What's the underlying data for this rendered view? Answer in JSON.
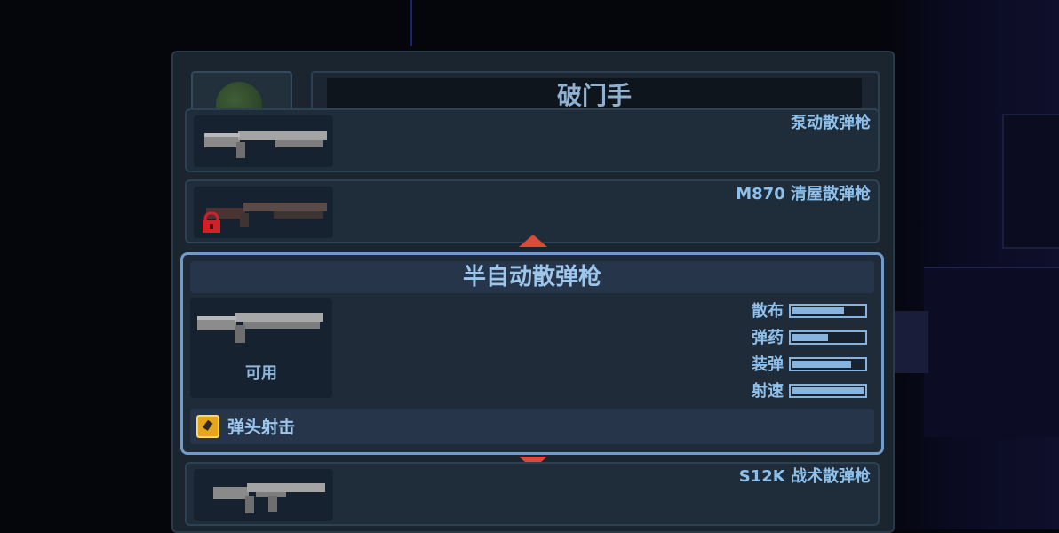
{
  "character": {
    "name": "破门手",
    "avatar_icon": "character-portrait-icon"
  },
  "weapons": [
    {
      "name": "泵动散弹枪",
      "locked": false,
      "icon": "shotgun-icon"
    },
    {
      "name": "M870 清屋散弹枪",
      "locked": true,
      "icon": "shotgun-icon"
    },
    {
      "name": "S12K 战术散弹枪",
      "locked": false,
      "icon": "tactical-shotgun-icon"
    }
  ],
  "selected": {
    "name": "半自动散弹枪",
    "status": "可用",
    "icon": "semi-auto-shotgun-icon",
    "stats": [
      {
        "label": "散布",
        "value": 0.72
      },
      {
        "label": "弹药",
        "value": 0.5
      },
      {
        "label": "装弹",
        "value": 0.82
      },
      {
        "label": "射速",
        "value": 1.0
      }
    ],
    "skill": {
      "label": "弹头射击",
      "icon": "bullet-skill-icon"
    }
  },
  "nav": {
    "up_icon": "arrow-up-icon",
    "down_icon": "arrow-down-icon"
  },
  "colors": {
    "accent": "#6f9ccb",
    "arrow": "#d94a3a",
    "lock": "#d0202a",
    "skill": "#e8a51b"
  }
}
